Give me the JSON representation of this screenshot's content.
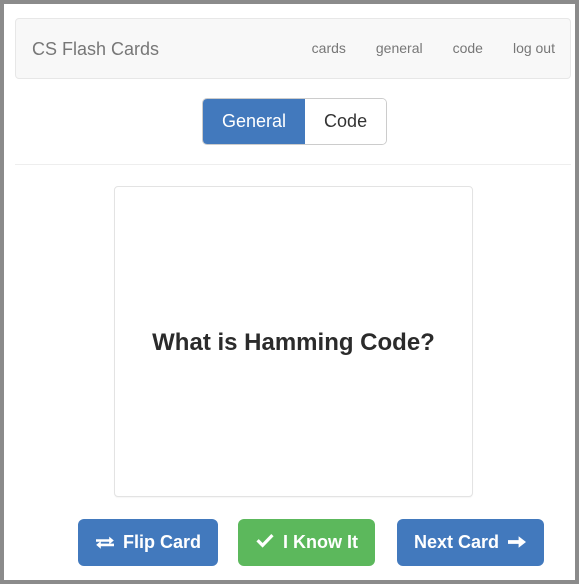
{
  "app": {
    "brand": "CS Flash Cards",
    "colors": {
      "primary": "#4279bd",
      "success": "#5cb85c",
      "navbar_bg": "#f8f8f8",
      "nav_text": "#777777",
      "card_border": "#e3e3e3",
      "frame_border": "#8b8b8b"
    }
  },
  "navbar": {
    "brand_label": "CS Flash Cards",
    "links": [
      {
        "label": "cards",
        "name": "nav-link-cards"
      },
      {
        "label": "general",
        "name": "nav-link-general"
      },
      {
        "label": "code",
        "name": "nav-link-code"
      },
      {
        "label": "log out",
        "name": "nav-link-log-out"
      }
    ]
  },
  "tabs": {
    "active": "General",
    "items": [
      {
        "label": "General",
        "active": true
      },
      {
        "label": "Code",
        "active": false
      }
    ]
  },
  "card": {
    "question": "What is Hamming Code?",
    "side": "front"
  },
  "actions": {
    "flip": {
      "label": "Flip Card",
      "icon": "exchange-icon",
      "glyph": "⇄",
      "style": "primary"
    },
    "know": {
      "label": "I Know It",
      "icon": "check-icon",
      "glyph": "✔",
      "style": "success"
    },
    "next": {
      "label": "Next Card",
      "icon": "arrow-right-icon",
      "glyph": "→",
      "style": "primary"
    }
  }
}
